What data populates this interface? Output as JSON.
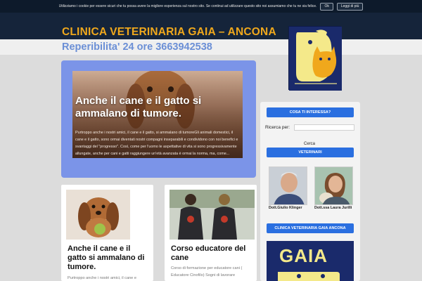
{
  "cookie_bar": {
    "text": "Utilizziamo i cookie per essere sicuri che tu possa avere la migliore esperienza sul nostro sito. Se continui ad utilizzare questo sito noi assumiamo che tu ne sia felice.",
    "ok_label": "Ok",
    "more_label": "Leggi di più"
  },
  "header": {
    "site_title": "CLINICA VETERINARIA GAIA – ANCONA",
    "subtitle": "Reperibilita' 24 ore 3663942538"
  },
  "featured_post": {
    "title": "Anche il cane e il gatto si ammalano di tumore.",
    "excerpt": "Purtroppo anche i nostri amici, il cane e il gatto, si ammalano di tumoreGli animali domestici, il cane e il gatto, sono ormai diventati nostri compagni inseparabili e condividono con noi benefici e svantaggi del \"progresso\". Così, come per l'uomo le aspettative di vita si sono progressivamente allungate, anche per cani e gatti raggiungere un'età avanzata è ormai la norma, ma, come..."
  },
  "sidebar": {
    "interest_button": "COSA TI INTERESSA?",
    "search_label": "Ricerca per:",
    "search_submit": "Cerca",
    "vets_button": "VETERINARI",
    "vets": [
      {
        "name": "Dott.Giulio Klinger"
      },
      {
        "name": "Dott.ssa Laura Jurilli"
      }
    ],
    "clinic_button": "CLINICA VETERINARIA GAIA ANCONA",
    "banner_text": "GAIA"
  },
  "posts": [
    {
      "title": "Anche il cane e il gatto si ammalano di tumore.",
      "excerpt": "Purtroppo anche i nostri amici, il cane e"
    },
    {
      "title": "Corso educatore del cane",
      "excerpt": "Corso di formazione per educatore cani ( Educatore Cinofilo)   Sogni di lavorare"
    }
  ],
  "colors": {
    "header_dark": "#15243a",
    "title_orange": "#f0a81c",
    "subtitle_blue": "#6b8fd6",
    "featured_bg": "#7b94e8",
    "button_blue": "#2a6fe0",
    "logo_navy": "#1a2a6b",
    "logo_yellow": "#f4e98a"
  },
  "icons": [
    "gaia-cat-dog-logo"
  ]
}
